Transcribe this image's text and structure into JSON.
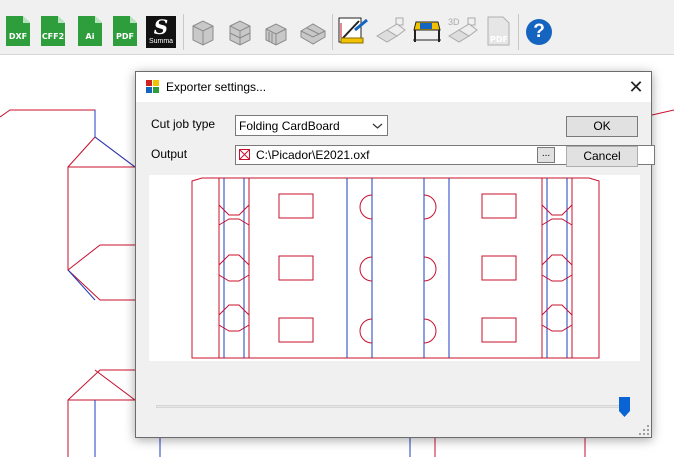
{
  "toolbar": {
    "buttons": [
      {
        "icon": "dxf-export-icon",
        "label": "DXF"
      },
      {
        "icon": "cff2-export-icon",
        "label": "CFF2"
      },
      {
        "icon": "ai-export-icon",
        "label": "Ai"
      },
      {
        "icon": "pdf-export-icon",
        "label": "PDF"
      },
      {
        "icon": "summa-export-icon",
        "label": "Summa",
        "glyph": "S"
      },
      {
        "icon": "cube-view-1-icon"
      },
      {
        "icon": "cube-view-2-icon"
      },
      {
        "icon": "cube-view-3-icon"
      },
      {
        "icon": "cube-view-4-icon"
      },
      {
        "icon": "measure-tool-icon"
      },
      {
        "icon": "fold-preview-icon"
      },
      {
        "icon": "table-layout-icon"
      },
      {
        "icon": "3d-view-icon",
        "label": "3D"
      },
      {
        "icon": "pdf-3d-icon",
        "label": "PDF"
      },
      {
        "icon": "help-icon",
        "glyph": "?"
      }
    ]
  },
  "dialog": {
    "title": "Exporter settings...",
    "close_glyph": "✕",
    "cut_job_type_label": "Cut job type",
    "cut_job_type_value": "Folding CardBoard",
    "output_label": "Output",
    "output_value": "C:\\Picador\\E2021.oxf",
    "browse_label": "...",
    "ok_label": "OK",
    "cancel_label": "Cancel",
    "slider_value": 1.0
  },
  "colors": {
    "cut_line": "#c8102e",
    "crease_line": "#1a3fbf",
    "accent": "#1565c0"
  }
}
